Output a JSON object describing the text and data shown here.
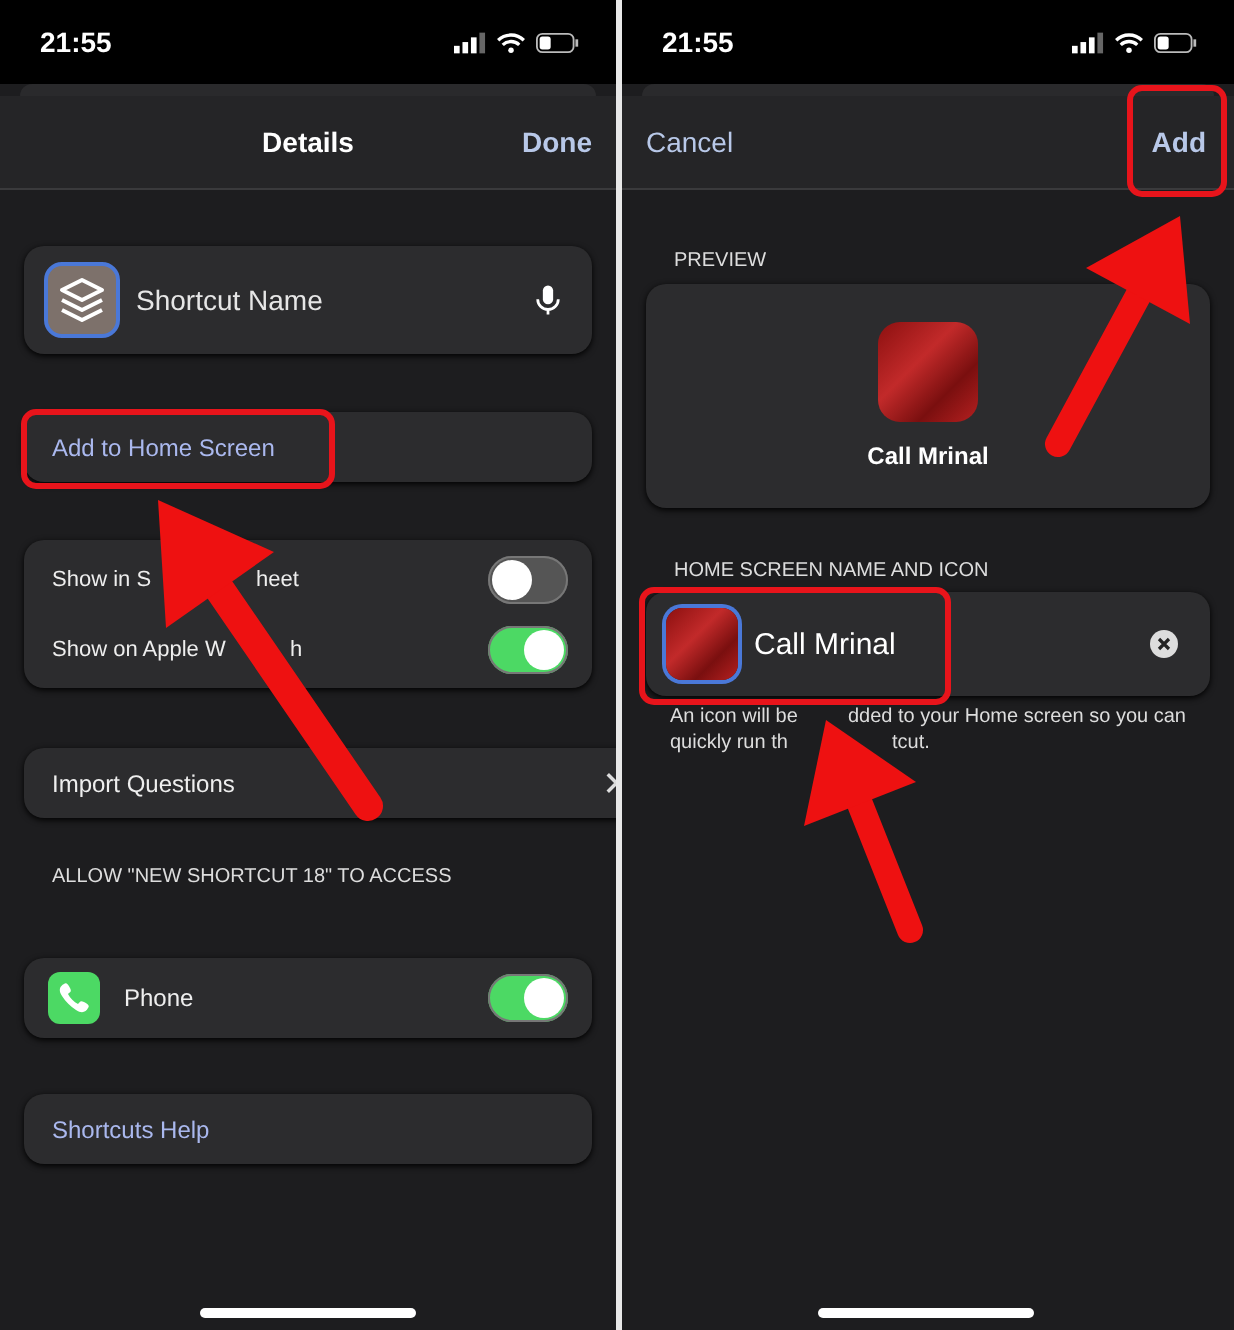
{
  "details_screen": {
    "status_bar": {
      "time": "21:55"
    },
    "nav": {
      "title": "Details",
      "action": "Done"
    },
    "name_field": {
      "value": "Shortcut Name"
    },
    "add_home_link": "Add to Home Screen",
    "toggles": [
      {
        "label_parts": [
          "Show in S",
          "heet"
        ],
        "on": false
      },
      {
        "label_parts": [
          "Show on Apple W",
          "h"
        ],
        "on": true
      }
    ],
    "import_row": "Import Questions",
    "access_header": "ALLOW \"NEW SHORTCUT 18\" TO ACCESS",
    "access_rows": [
      {
        "label": "Phone",
        "on": true
      }
    ],
    "help_link": "Shortcuts Help"
  },
  "add_screen": {
    "status_bar": {
      "time": "21:55"
    },
    "nav": {
      "cancel": "Cancel",
      "action": "Add"
    },
    "preview_header": "PREVIEW",
    "preview_label": "Call Mrinal",
    "name_header": "HOME SCREEN NAME AND ICON",
    "name_field": {
      "value": "Call Mrinal"
    },
    "caption_lines": [
      [
        "An icon will be",
        "dded to your Home screen so you can"
      ],
      [
        "quickly run th",
        "tcut."
      ]
    ]
  }
}
